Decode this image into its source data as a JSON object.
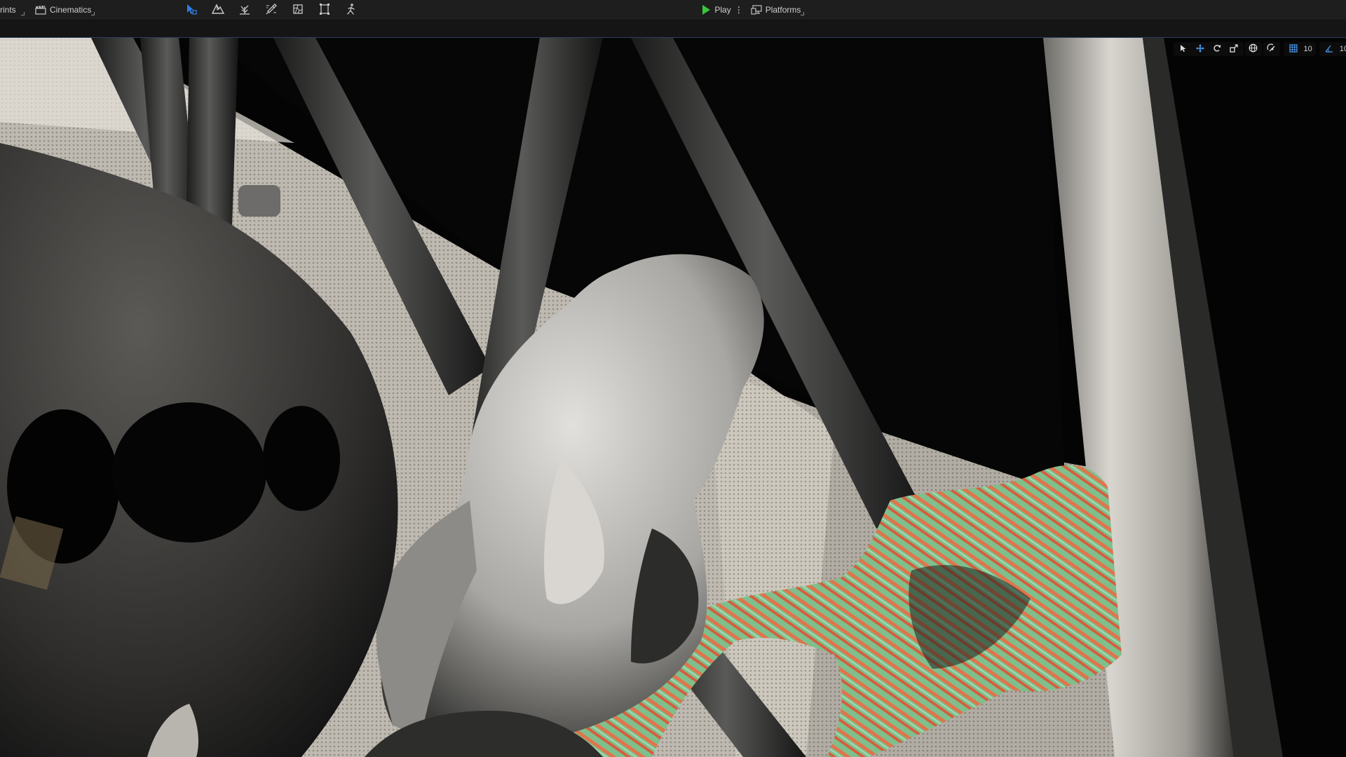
{
  "toolbar": {
    "blueprints_label": "rints",
    "cinematics_label": "Cinematics",
    "tools": [
      {
        "icon": "select-mode-icon",
        "active": true
      },
      {
        "icon": "landscape-mode-icon"
      },
      {
        "icon": "foliage-mode-icon"
      },
      {
        "icon": "mesh-paint-mode-icon"
      },
      {
        "icon": "fracture-mode-icon"
      },
      {
        "icon": "brush-edit-mode-icon"
      },
      {
        "icon": "animation-mode-icon"
      }
    ],
    "play_label": "Play",
    "platforms_label": "Platforms"
  },
  "viewport_toolbar": {
    "grid_snap_value": "10",
    "rotation_snap_value": "10"
  },
  "colors": {
    "accent_blue": "#2f7de1",
    "play_green": "#39c63b",
    "toolbar_bg": "#1e1e1e"
  }
}
